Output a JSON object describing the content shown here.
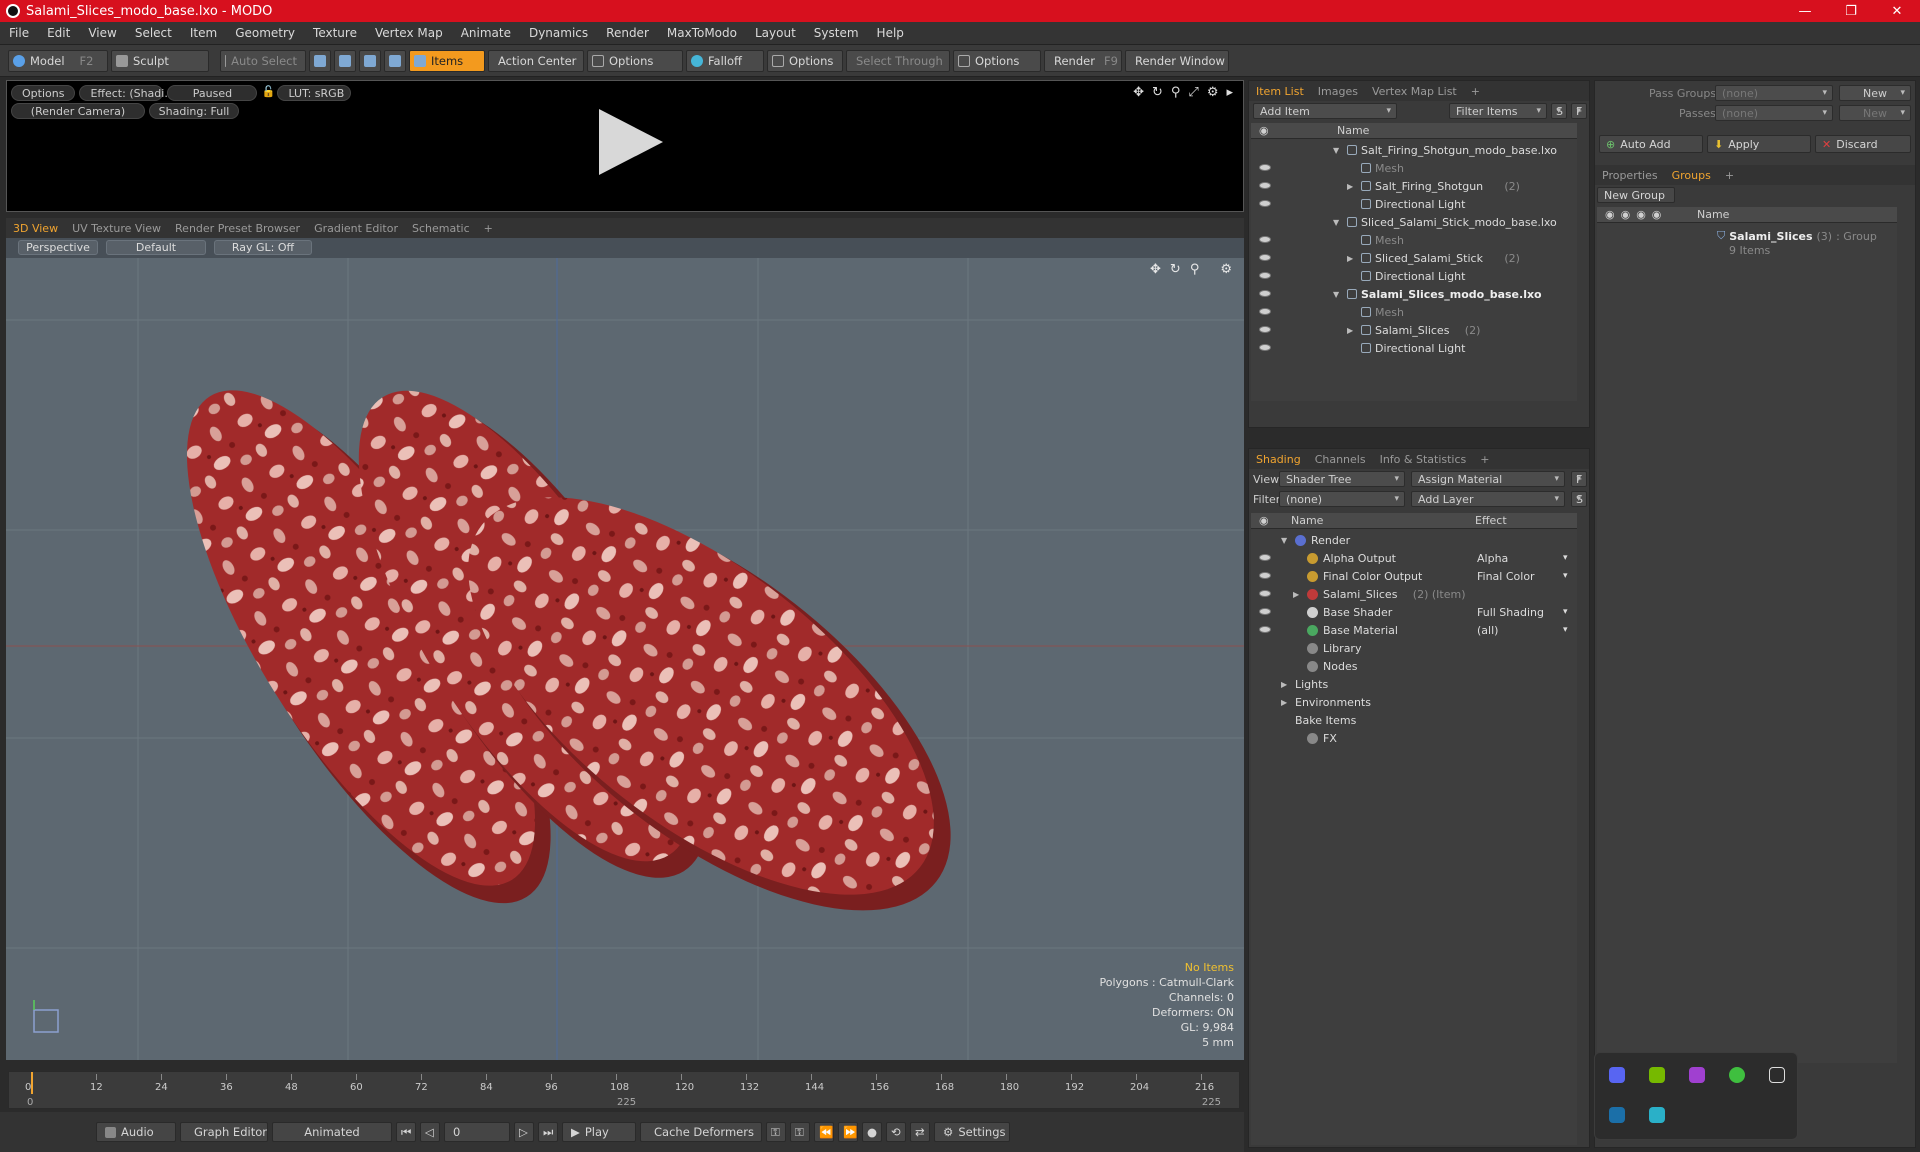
{
  "window": {
    "title": "Salami_Slices_modo_base.lxo - MODO",
    "controls": [
      "—",
      "❐",
      "✕"
    ]
  },
  "menu": [
    "File",
    "Edit",
    "View",
    "Select",
    "Item",
    "Geometry",
    "Texture",
    "Vertex Map",
    "Animate",
    "Dynamics",
    "Render",
    "MaxToModo",
    "Layout",
    "System",
    "Help"
  ],
  "toolbar": {
    "model": "Model",
    "model_key": "F2",
    "sculpt": "Sculpt",
    "auto_select": "Auto Select",
    "items": "Items",
    "action_center": "Action Center",
    "options1": "Options",
    "falloff": "Falloff",
    "options2": "Options",
    "select_through": "Select Through",
    "options3": "Options",
    "render": "Render",
    "render_key": "F9",
    "render_window": "Render Window"
  },
  "preview": {
    "options": "Options",
    "effect": "Effect: (Shadi...",
    "paused": "Paused",
    "lut": "LUT: sRGB",
    "camera": "(Render Camera)",
    "shading": "Shading: Full"
  },
  "view_tabs": [
    "3D View",
    "UV Texture View",
    "Render Preset Browser",
    "Gradient Editor",
    "Schematic",
    "+"
  ],
  "viewport": {
    "perspective": "Perspective",
    "default": "Default",
    "raygl": "Ray GL: Off",
    "hud": {
      "no_items": "No Items",
      "polygons": "Polygons : Catmull-Clark",
      "channels": "Channels: 0",
      "deformers": "Deformers: ON",
      "gl": "GL: 9,984",
      "unit": "5 mm"
    }
  },
  "timeline": {
    "ticks": [
      "0",
      "12",
      "24",
      "36",
      "48",
      "60",
      "72",
      "84",
      "96",
      "108",
      "120",
      "132",
      "144",
      "156",
      "168",
      "180",
      "192",
      "204",
      "216"
    ],
    "start": "0",
    "mid": "225",
    "end": "225"
  },
  "bottom": {
    "audio": "Audio",
    "graph_editor": "Graph Editor",
    "animated": "Animated",
    "frame": "0",
    "play": "Play",
    "cache_deformers": "Cache Deformers",
    "settings": "Settings"
  },
  "item_list": {
    "tabs": [
      "Item List",
      "Images",
      "Vertex Map List",
      "+"
    ],
    "add_item": "Add Item",
    "filter_items": "Filter Items",
    "s": "S",
    "f": "F",
    "col_name": "Name",
    "rows": [
      {
        "label": "Salt_Firing_Shotgun_modo_base.lxo",
        "indent": 0,
        "style": "normal",
        "eye": false,
        "arrow": "▼"
      },
      {
        "label": "Mesh",
        "indent": 1,
        "style": "dim",
        "eye": true,
        "arrow": ""
      },
      {
        "label": "Salt_Firing_Shotgun",
        "count": "(2)",
        "indent": 1,
        "style": "normal",
        "eye": true,
        "arrow": "▶"
      },
      {
        "label": "Directional Light",
        "indent": 1,
        "style": "normal",
        "eye": true,
        "arrow": ""
      },
      {
        "label": "Sliced_Salami_Stick_modo_base.lxo",
        "indent": 0,
        "style": "normal",
        "eye": false,
        "arrow": "▼"
      },
      {
        "label": "Mesh",
        "indent": 1,
        "style": "dim",
        "eye": true,
        "arrow": ""
      },
      {
        "label": "Sliced_Salami_Stick",
        "count": "(2)",
        "indent": 1,
        "style": "normal",
        "eye": true,
        "arrow": "▶"
      },
      {
        "label": "Directional Light",
        "indent": 1,
        "style": "normal",
        "eye": true,
        "arrow": ""
      },
      {
        "label": "Salami_Slices_modo_base.lxo",
        "indent": 0,
        "style": "bold",
        "eye": true,
        "arrow": "▼"
      },
      {
        "label": "Mesh",
        "indent": 1,
        "style": "dim",
        "eye": true,
        "arrow": ""
      },
      {
        "label": "Salami_Slices",
        "count": "(2)",
        "indent": 1,
        "style": "normal",
        "eye": true,
        "arrow": "▶"
      },
      {
        "label": "Directional Light",
        "indent": 1,
        "style": "normal",
        "eye": true,
        "arrow": ""
      }
    ]
  },
  "shading": {
    "tabs": [
      "Shading",
      "Channels",
      "Info & Statistics",
      "+"
    ],
    "view_label": "View",
    "view_value": "Shader Tree",
    "assign_material": "Assign Material",
    "f": "F",
    "filter_label": "Filter",
    "filter_value": "(none)",
    "add_layer": "Add Layer",
    "s": "S",
    "col_name": "Name",
    "col_effect": "Effect",
    "rows": [
      {
        "label": "Render",
        "indent": 0,
        "effect": "",
        "eye": false,
        "arrow": "▼",
        "icon": "#5a6fd0"
      },
      {
        "label": "Alpha Output",
        "indent": 1,
        "effect": "Alpha",
        "eye": true,
        "arrow": "",
        "icon": "#c89b30"
      },
      {
        "label": "Final Color Output",
        "indent": 1,
        "effect": "Final Color",
        "eye": true,
        "arrow": "",
        "icon": "#c89b30"
      },
      {
        "label": "Salami_Slices",
        "count": "(2) (Item)",
        "indent": 1,
        "effect": "",
        "eye": true,
        "arrow": "▶",
        "icon": "#c03a3a"
      },
      {
        "label": "Base Shader",
        "indent": 1,
        "effect": "Full Shading",
        "eye": true,
        "arrow": "",
        "icon": "#d0d0d0"
      },
      {
        "label": "Base Material",
        "indent": 1,
        "effect": "(all)",
        "eye": true,
        "arrow": "",
        "icon": "#4aa860"
      },
      {
        "label": "Library",
        "indent": -1,
        "effect": "",
        "eye": false,
        "arrow": "",
        "icon": "#888"
      },
      {
        "label": "Nodes",
        "indent": -1,
        "effect": "",
        "eye": false,
        "arrow": "",
        "icon": "#888"
      },
      {
        "label": "Lights",
        "indent": -2,
        "effect": "",
        "eye": false,
        "arrow": "▶",
        "icon": ""
      },
      {
        "label": "Environments",
        "indent": -2,
        "effect": "",
        "eye": false,
        "arrow": "▶",
        "icon": ""
      },
      {
        "label": "Bake Items",
        "indent": -2,
        "effect": "",
        "eye": false,
        "arrow": "",
        "icon": ""
      },
      {
        "label": "FX",
        "indent": -1,
        "effect": "",
        "eye": false,
        "arrow": "",
        "icon": "#888"
      }
    ]
  },
  "groups_panel": {
    "pass_groups": "Pass Groups",
    "passes": "Passes",
    "none": "(none)",
    "new": "New",
    "auto_add": "Auto Add",
    "apply": "Apply",
    "discard": "Discard",
    "tabs": [
      "Properties",
      "Groups",
      "+"
    ],
    "new_group": "New Group",
    "col_name": "Name",
    "group": {
      "name": "Salami_Slices",
      "count": "(3)",
      "type": ": Group",
      "items": "9 Items"
    }
  },
  "colors": {
    "accent": "#f39a1e",
    "title_red": "#d7101e",
    "viewport": "#5d6871"
  }
}
